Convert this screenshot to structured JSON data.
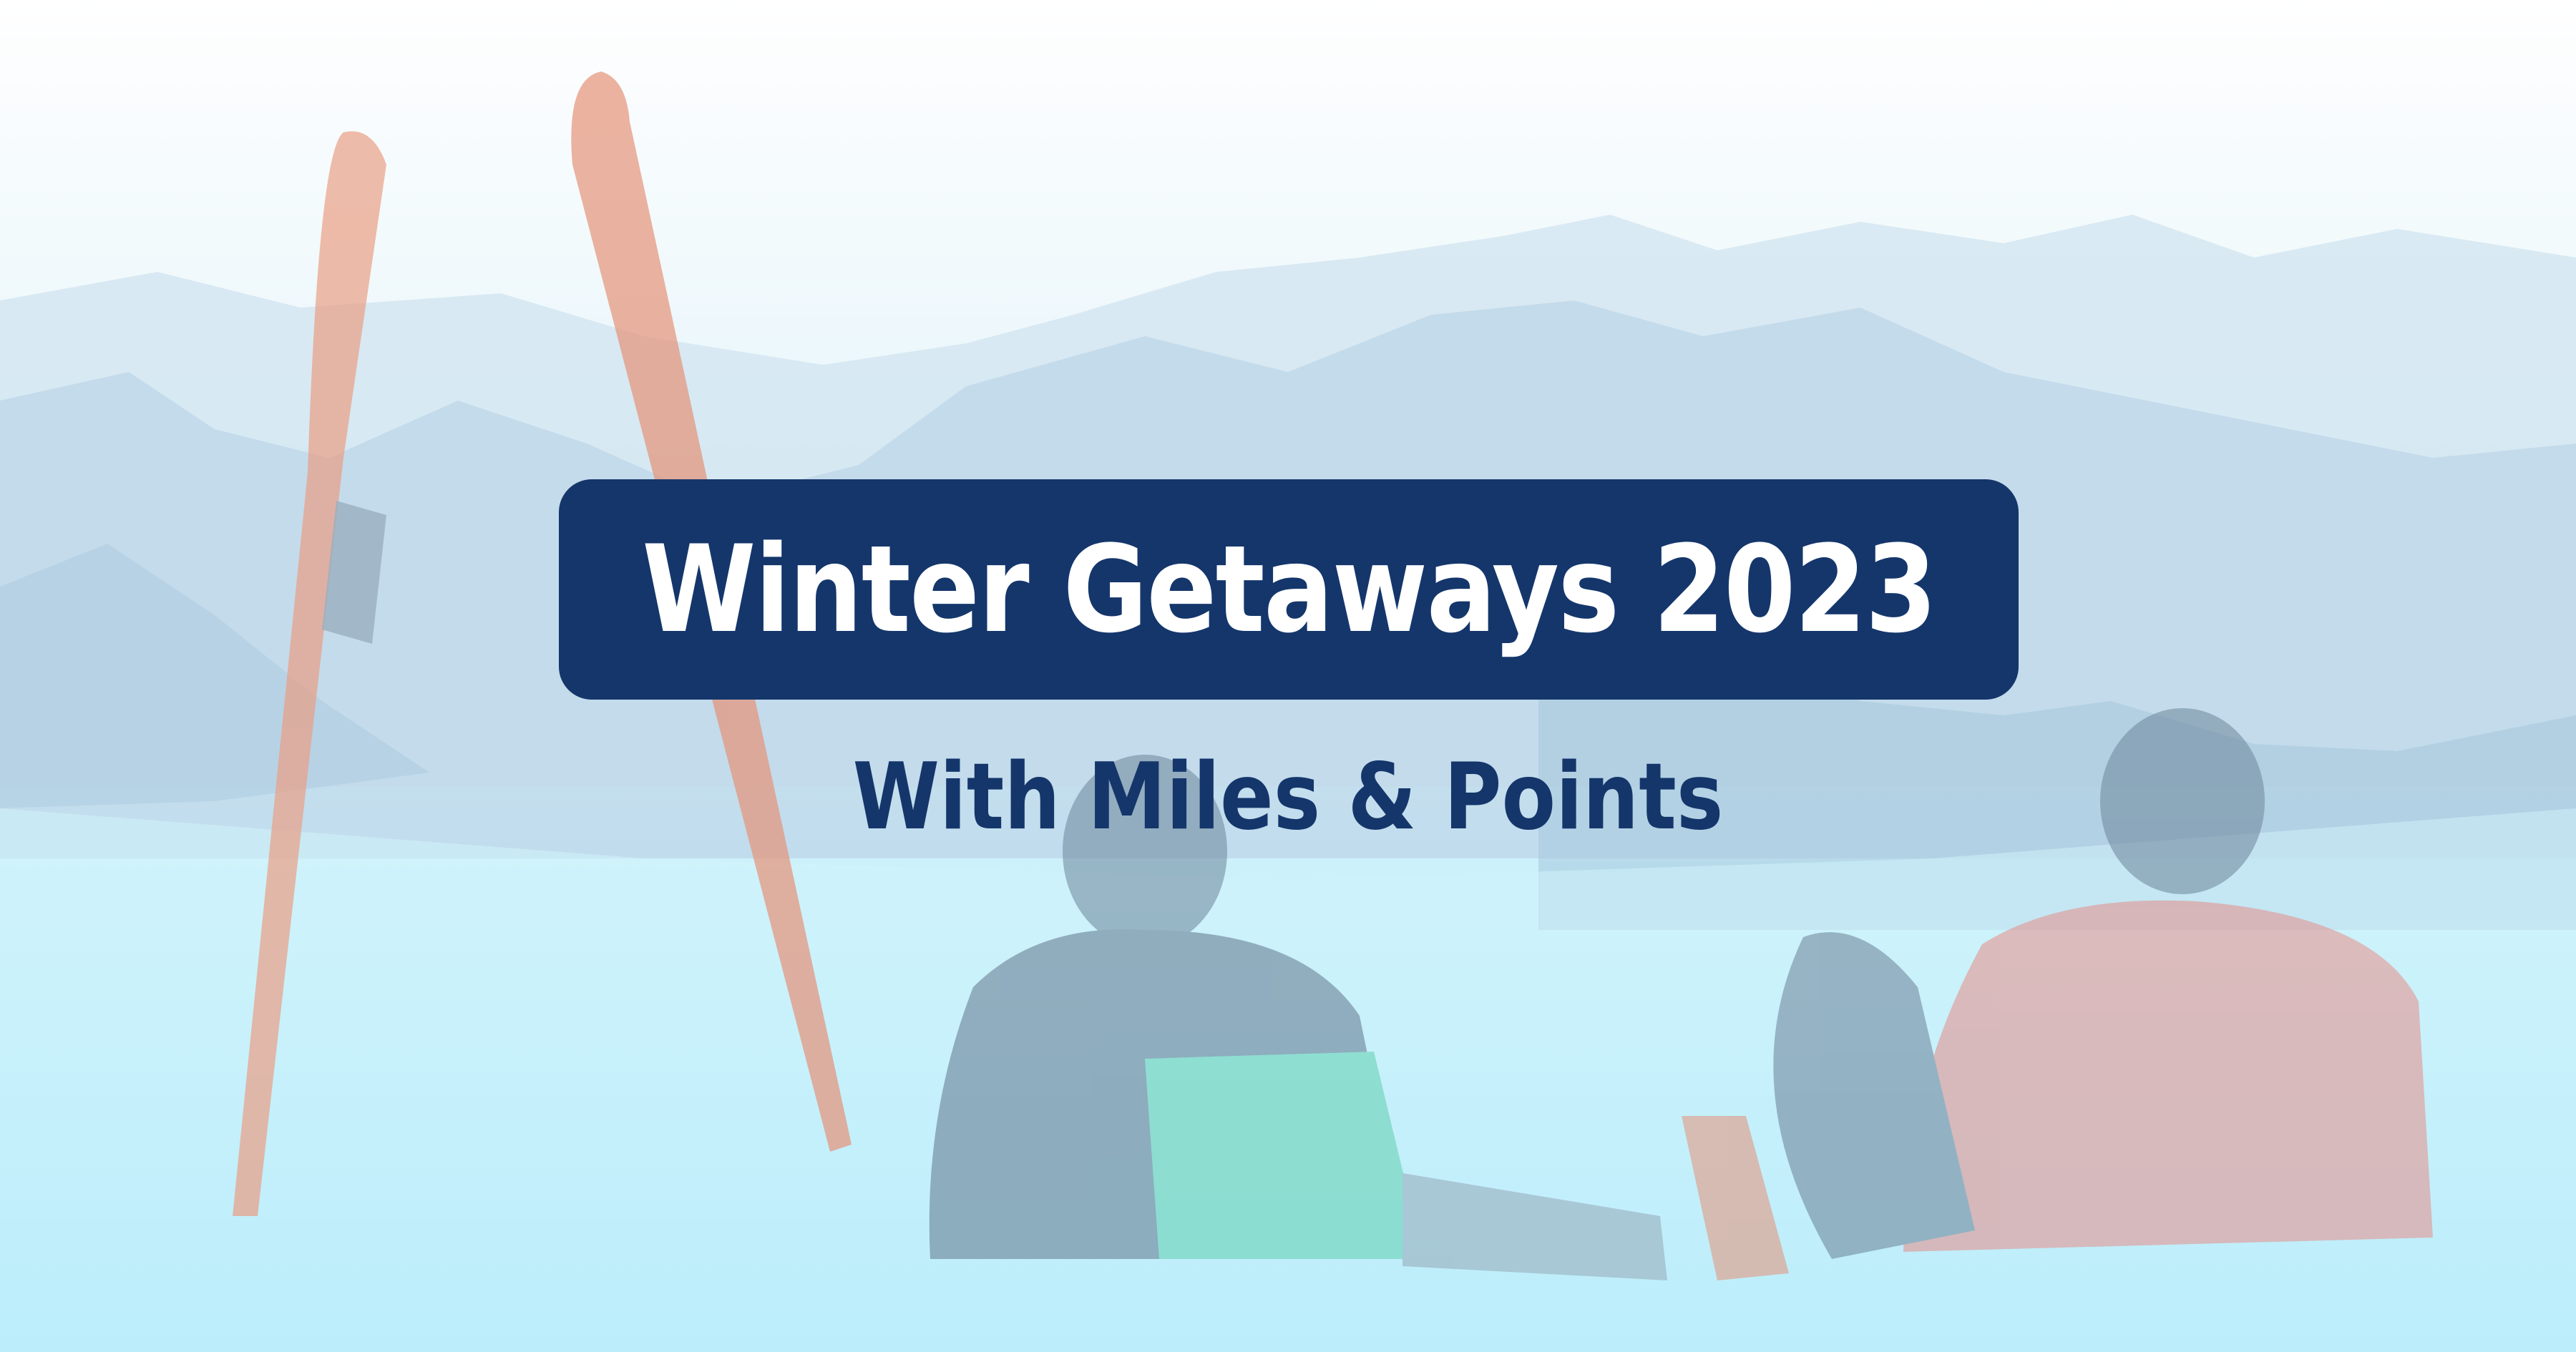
{
  "banner": {
    "title": "Winter Getaways 2023",
    "subtitle": "With Miles & Points"
  },
  "colors": {
    "title_box": "#14366b",
    "title_text": "#ffffff",
    "subtitle_text": "#14366b",
    "snow_bottom": "#93e3f8"
  },
  "icons": [
    "mountain-range",
    "skis",
    "skier-green-jacket",
    "skier-red-jacket"
  ]
}
